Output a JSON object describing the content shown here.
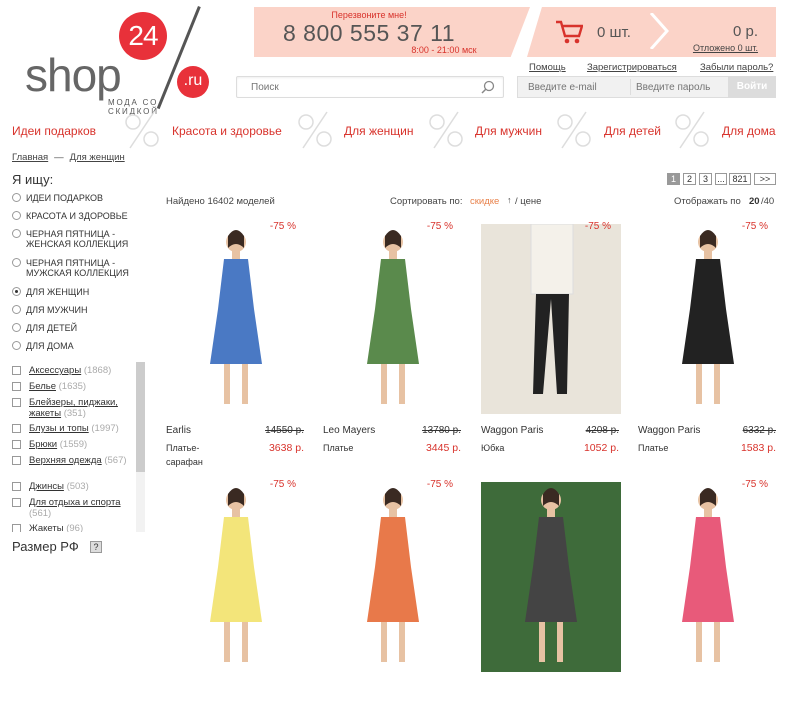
{
  "logo": {
    "text": "shop",
    "number": "24",
    "domain": ".ru",
    "tagline": "МОДА СО СКИДКОЙ"
  },
  "phone": {
    "call_me": "Перезвоните мне!",
    "number": "8 800 555 37 11",
    "hours": "8:00 - 21:00 мск"
  },
  "cart": {
    "count": "0 шт.",
    "sum": "0 р.",
    "deferred": "Отложено 0 шт.",
    "icon": "cart-icon"
  },
  "top_links": {
    "help": "Помощь",
    "register": "Зарегистрироваться",
    "forgot": "Забыли пароль?"
  },
  "search": {
    "placeholder": "Поиск"
  },
  "login": {
    "email_placeholder": "Введите e-mail",
    "password_placeholder": "Введите пароль",
    "submit": "Войти"
  },
  "categories": [
    "Идеи подарков",
    "Красота и здоровье",
    "Для женщин",
    "Для мужчин",
    "Для детей",
    "Для дома"
  ],
  "breadcrumb": {
    "home": "Главная",
    "current": "Для женщин"
  },
  "sidebar": {
    "title": "Я ищу:",
    "radios": [
      {
        "label": "Идеи подарков",
        "checked": false
      },
      {
        "label": "Красота и здоровье",
        "checked": false
      },
      {
        "label": "Черная пятница - женская коллекция",
        "checked": false
      },
      {
        "label": "Черная пятница - мужская коллекция",
        "checked": false
      },
      {
        "label": "Для женщин",
        "checked": true
      },
      {
        "label": "Для мужчин",
        "checked": false
      },
      {
        "label": "Для детей",
        "checked": false
      },
      {
        "label": "Для дома",
        "checked": false
      }
    ],
    "checkboxes": [
      {
        "name": "Аксессуары",
        "count": "(1868)"
      },
      {
        "name": "Белье",
        "count": "(1635)"
      },
      {
        "name": "Блейзеры, пиджаки, жакеты",
        "count": "(351)"
      },
      {
        "name": "Блузы и топы",
        "count": "(1997)"
      },
      {
        "name": "Брюки",
        "count": "(1559)"
      },
      {
        "name": "Верхняя одежда",
        "count": "(567)"
      },
      {
        "name": "Джинсы",
        "count": "(503)"
      },
      {
        "name": "Для отдыха и спорта",
        "count": "(561)"
      },
      {
        "name": "Жакеты",
        "count": "(96)"
      }
    ],
    "size_title": "Размер РФ",
    "size_help": "?"
  },
  "listing": {
    "found": "Найдено 16402 моделей",
    "sort_label": "Сортировать по:",
    "sort_active": "скидке",
    "sort_arrow": "↑",
    "sort_other": "/ цене",
    "show_label": "Отображать по",
    "show_20": "20",
    "show_40": "/40",
    "pages": [
      "1",
      "2",
      "3",
      "...",
      "821",
      ">>"
    ]
  },
  "products": [
    {
      "discount": "-75 %",
      "brand": "Earlis",
      "type": "Платье-сарафан",
      "old": "14550 р.",
      "price": "3638 р.",
      "dress": "#4a79c4"
    },
    {
      "discount": "-75 %",
      "brand": "Leo Mayers",
      "type": "Платье",
      "old": "13780 р.",
      "price": "3445 р.",
      "dress": "#5a8a4c"
    },
    {
      "discount": "-75 %",
      "brand": "Waggon Paris",
      "type": "Юбка",
      "old": "4208 р.",
      "price": "1052 р.",
      "dress": "#f4f1ea"
    },
    {
      "discount": "-75 %",
      "brand": "Waggon Paris",
      "type": "Платье",
      "old": "6332 р.",
      "price": "1583 р.",
      "dress": "#222222"
    },
    {
      "discount": "-75 %",
      "dress": "#f3e57a"
    },
    {
      "discount": "-75 %",
      "dress": "#e8794a"
    },
    {
      "discount": "",
      "dress": "#444444"
    },
    {
      "discount": "-75 %",
      "dress": "#e85a7a"
    }
  ]
}
